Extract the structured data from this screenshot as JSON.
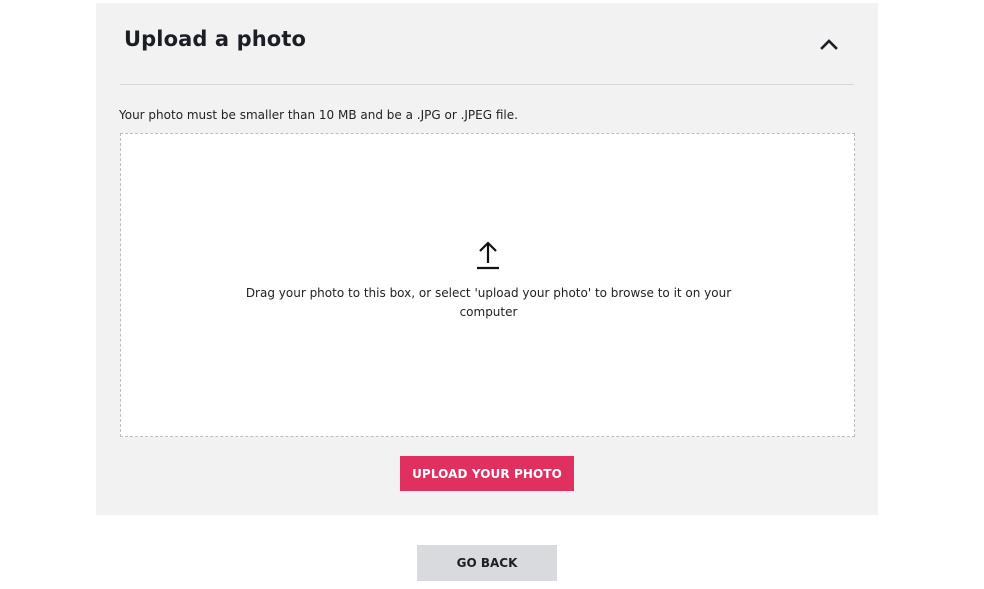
{
  "upload_panel": {
    "title": "Upload a photo",
    "collapse_icon": "chevron-up-icon",
    "requirements": "Your photo must be smaller than 10 MB and be a .JPG or .JPEG file.",
    "dropzone": {
      "icon": "upload-arrow-icon",
      "instructions": "Drag your photo to this box, or select 'upload your photo' to browse to it on your computer"
    },
    "upload_button_label": "UPLOAD YOUR PHOTO"
  },
  "back_button_label": "GO BACK",
  "colors": {
    "panel_background": "#f2f2f2",
    "accent": "#e0305f",
    "secondary_button": "#d9dadd"
  }
}
